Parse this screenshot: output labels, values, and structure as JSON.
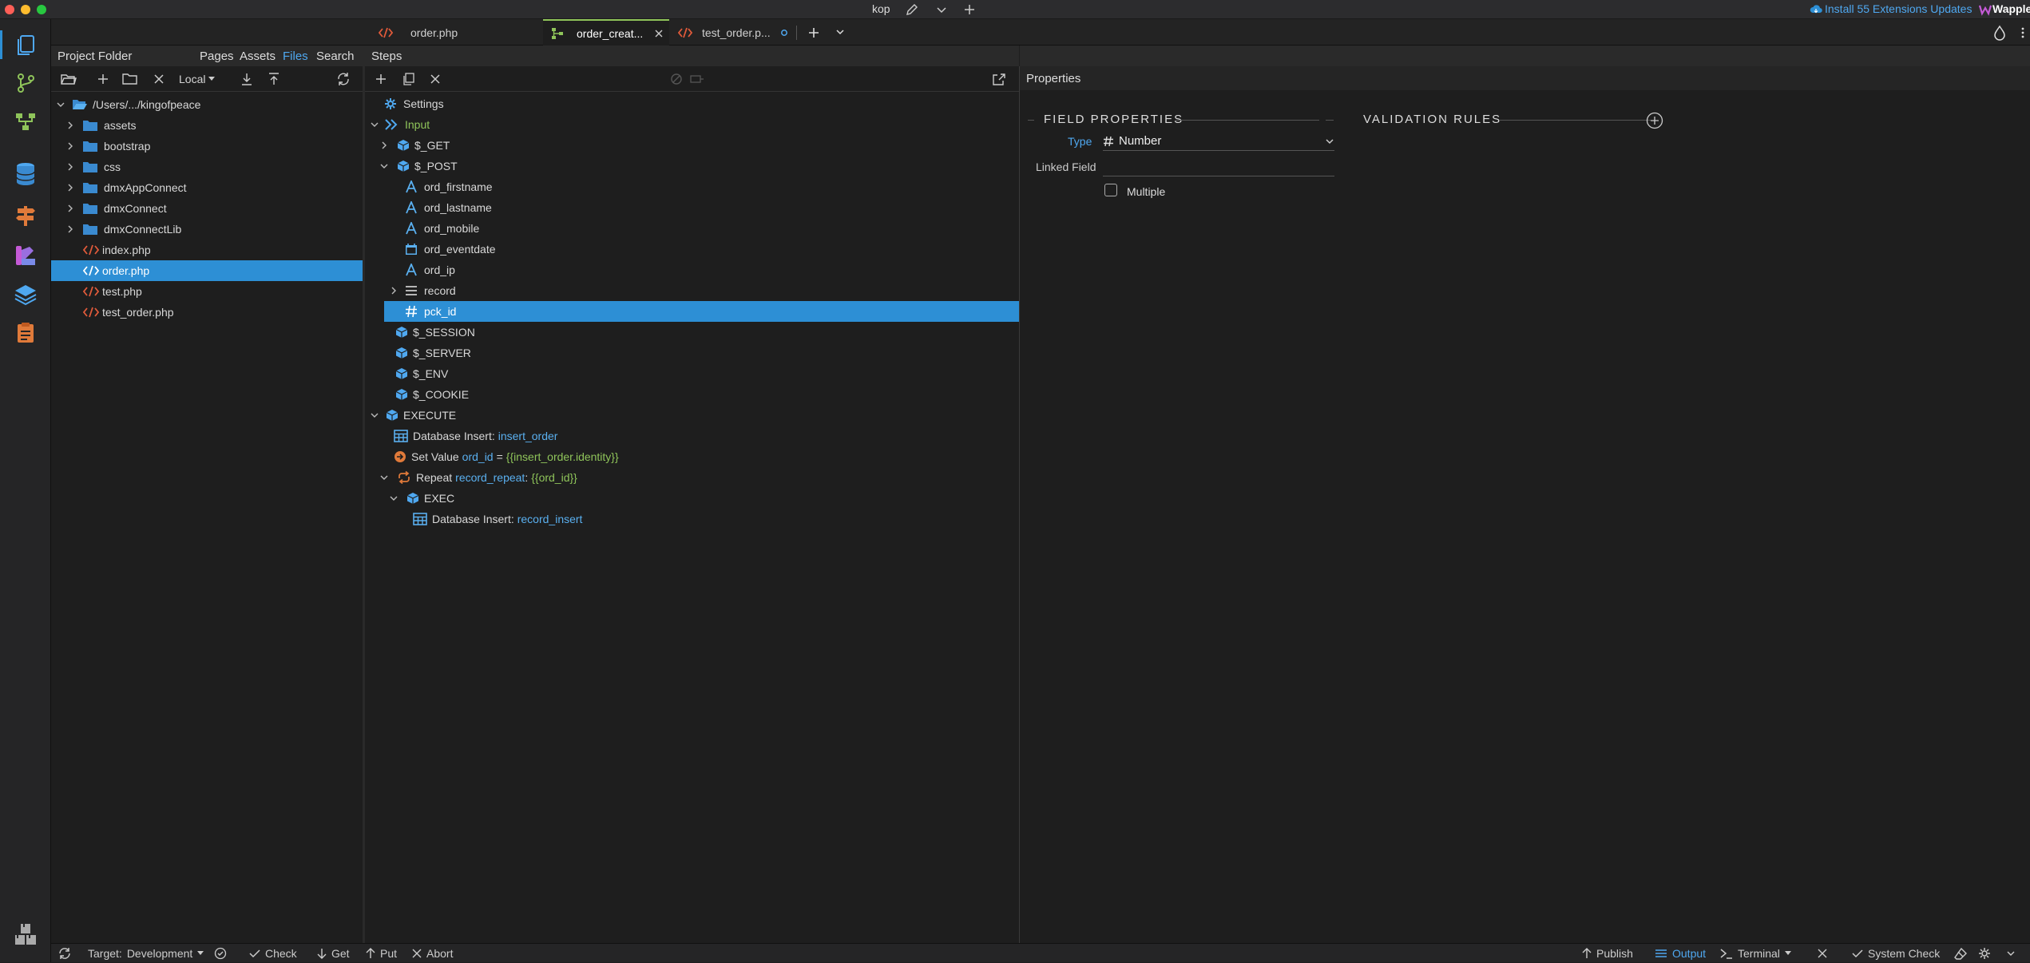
{
  "titlebar": {
    "project": "kop",
    "extensions_update": "Install 55 Extensions Updates",
    "brand": "Wappler"
  },
  "tabs": [
    {
      "label": "order.php"
    },
    {
      "label": "order_creat..."
    },
    {
      "label": "test_order.p..."
    }
  ],
  "project_panel": {
    "title": "Project Folder",
    "nav": [
      "Pages",
      "Assets",
      "Files",
      "Search"
    ],
    "active_nav": "Files",
    "target_select": "Local",
    "root": "/Users/.../kingofpeace",
    "folders": [
      "assets",
      "bootstrap",
      "css",
      "dmxAppConnect",
      "dmxConnect",
      "dmxConnectLib"
    ],
    "files": [
      "index.php",
      "order.php",
      "test.php",
      "test_order.php"
    ],
    "selected_file": "order.php"
  },
  "steps_panel": {
    "title": "Steps",
    "settings": "Settings",
    "input": "Input",
    "get": "$_GET",
    "post": "$_POST",
    "post_fields": [
      "ord_firstname",
      "ord_lastname",
      "ord_mobile",
      "ord_eventdate",
      "ord_ip",
      "record",
      "pck_id"
    ],
    "session": "$_SESSION",
    "server": "$_SERVER",
    "env": "$_ENV",
    "cookie": "$_COOKIE",
    "execute": "EXECUTE",
    "db_insert_label": "Database Insert:",
    "db_insert_name": "insert_order",
    "set_value_label": "Set Value",
    "set_value_name": "ord_id",
    "set_value_eq": "=",
    "set_value_expr": "{{insert_order.identity}}",
    "repeat_label": "Repeat",
    "repeat_name": "record_repeat",
    "repeat_expr": "{{ord_id}}",
    "exec": "EXEC",
    "db_insert2_label": "Database Insert:",
    "db_insert2_name": "record_insert"
  },
  "properties_panel": {
    "title": "Properties",
    "field_properties": "FIELD PROPERTIES",
    "validation_rules": "VALIDATION RULES",
    "type_label": "Type",
    "type_value": "Number",
    "linked_field_label": "Linked Field",
    "linked_field_value": "",
    "multiple_label": "Multiple"
  },
  "bottom": {
    "target_label": "Target:",
    "target_value": "Development",
    "check": "Check",
    "get": "Get",
    "put": "Put",
    "abort": "Abort",
    "publish": "Publish",
    "output": "Output",
    "terminal": "Terminal",
    "system_check": "System Check"
  },
  "colors": {
    "accent": "#2d8fd5",
    "link": "#5ab0f0",
    "green": "#8fc45a",
    "php": "#e05a3a"
  }
}
